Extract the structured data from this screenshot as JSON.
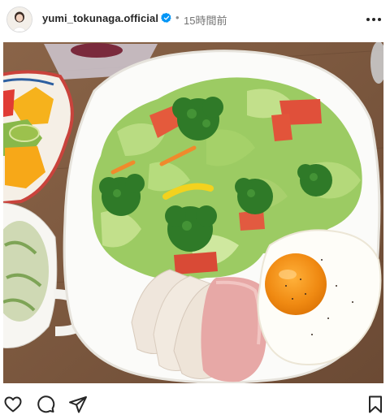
{
  "post": {
    "username": "yumi_tokunaga.official",
    "verified": true,
    "separator": "•",
    "timestamp": "15時間前"
  },
  "icons": {
    "avatar": "profile-avatar",
    "verified": "verified-badge-icon",
    "more": "more-options-icon",
    "like": "heart-icon",
    "comment": "comment-icon",
    "share": "share-icon",
    "save": "bookmark-icon"
  },
  "colors": {
    "text": "#262626",
    "secondary": "#737373",
    "verified": "#0095f6"
  }
}
